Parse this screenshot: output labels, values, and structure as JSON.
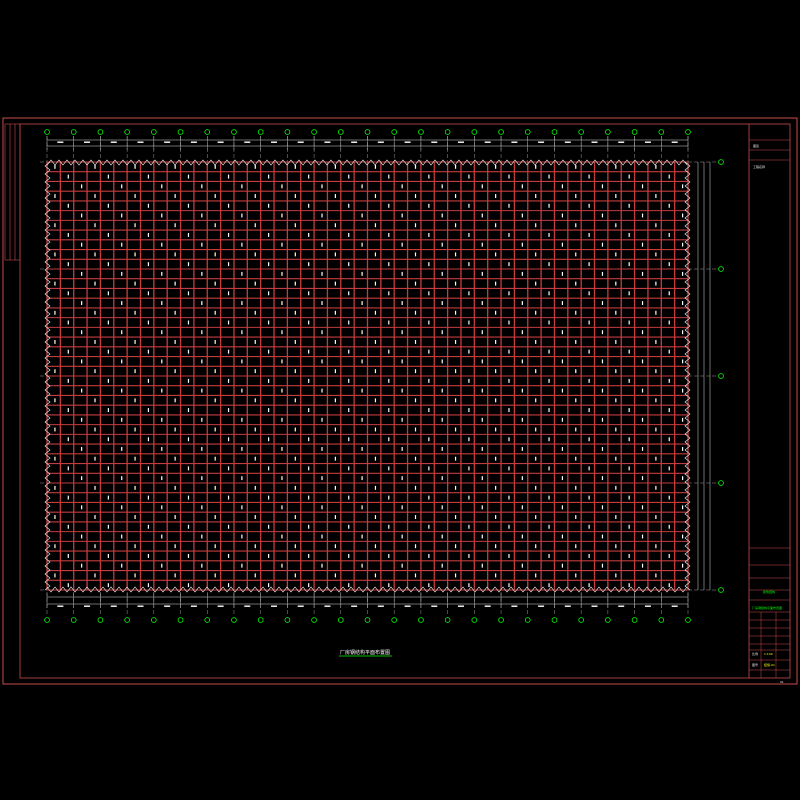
{
  "drawing": {
    "title": "厂房钢结构平面布置图",
    "colors": {
      "background": "#000000",
      "frame": "#c94a4a",
      "steel_members": "#c43c3c",
      "bracing": "#ffffff",
      "grid_line": "#d8d8d8",
      "axis_bubble": "#00ff00",
      "title_underline": "#00ff00"
    },
    "grid": {
      "column_axis_count": 25,
      "row_axis_count": 5
    }
  },
  "title_block": {
    "company_label": "图签",
    "project_label": "工程名称",
    "drawing_name": "厂房钢结构平面布置图",
    "stamp_label": "建筑结构",
    "scale_label": "比例",
    "scale_value": "1:100",
    "sheet_label": "图号",
    "sheet_value": "结施-01",
    "page_number": "01"
  }
}
